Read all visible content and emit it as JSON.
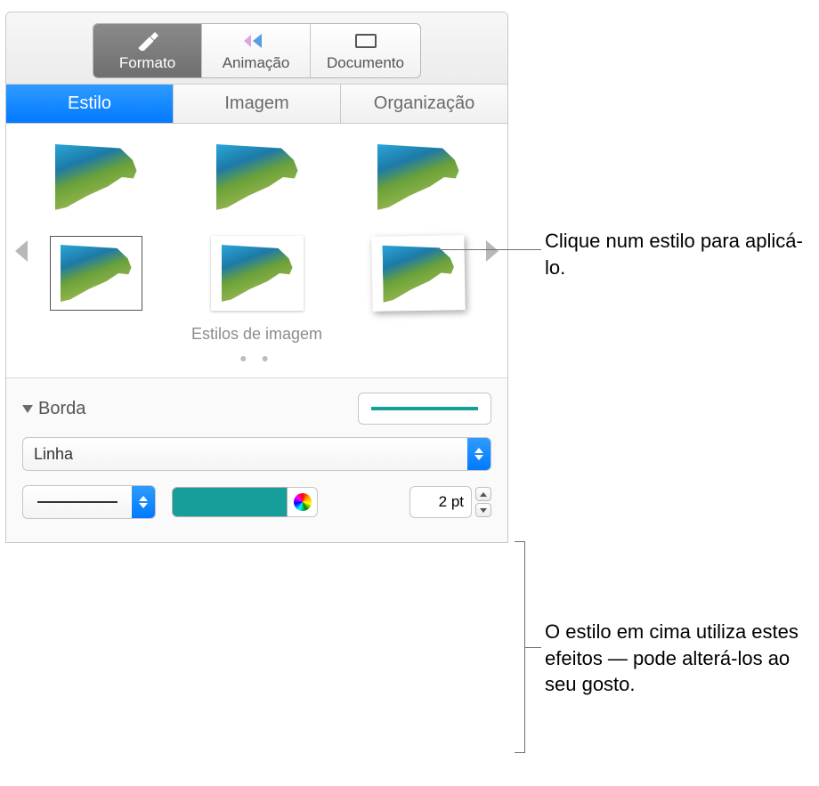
{
  "toolbar": {
    "format": "Formato",
    "animation": "Animação",
    "document": "Documento"
  },
  "tabs": {
    "style": "Estilo",
    "image": "Imagem",
    "arrange": "Organização"
  },
  "styles": {
    "caption": "Estilos de imagem"
  },
  "border": {
    "title": "Borda",
    "type": "Linha",
    "size_value": "2 pt",
    "color": "#159e9a"
  },
  "callouts": {
    "apply": "Clique num estilo para aplicá-lo.",
    "effects": "O estilo em cima utiliza estes efeitos — pode alterá-los ao seu gosto."
  }
}
